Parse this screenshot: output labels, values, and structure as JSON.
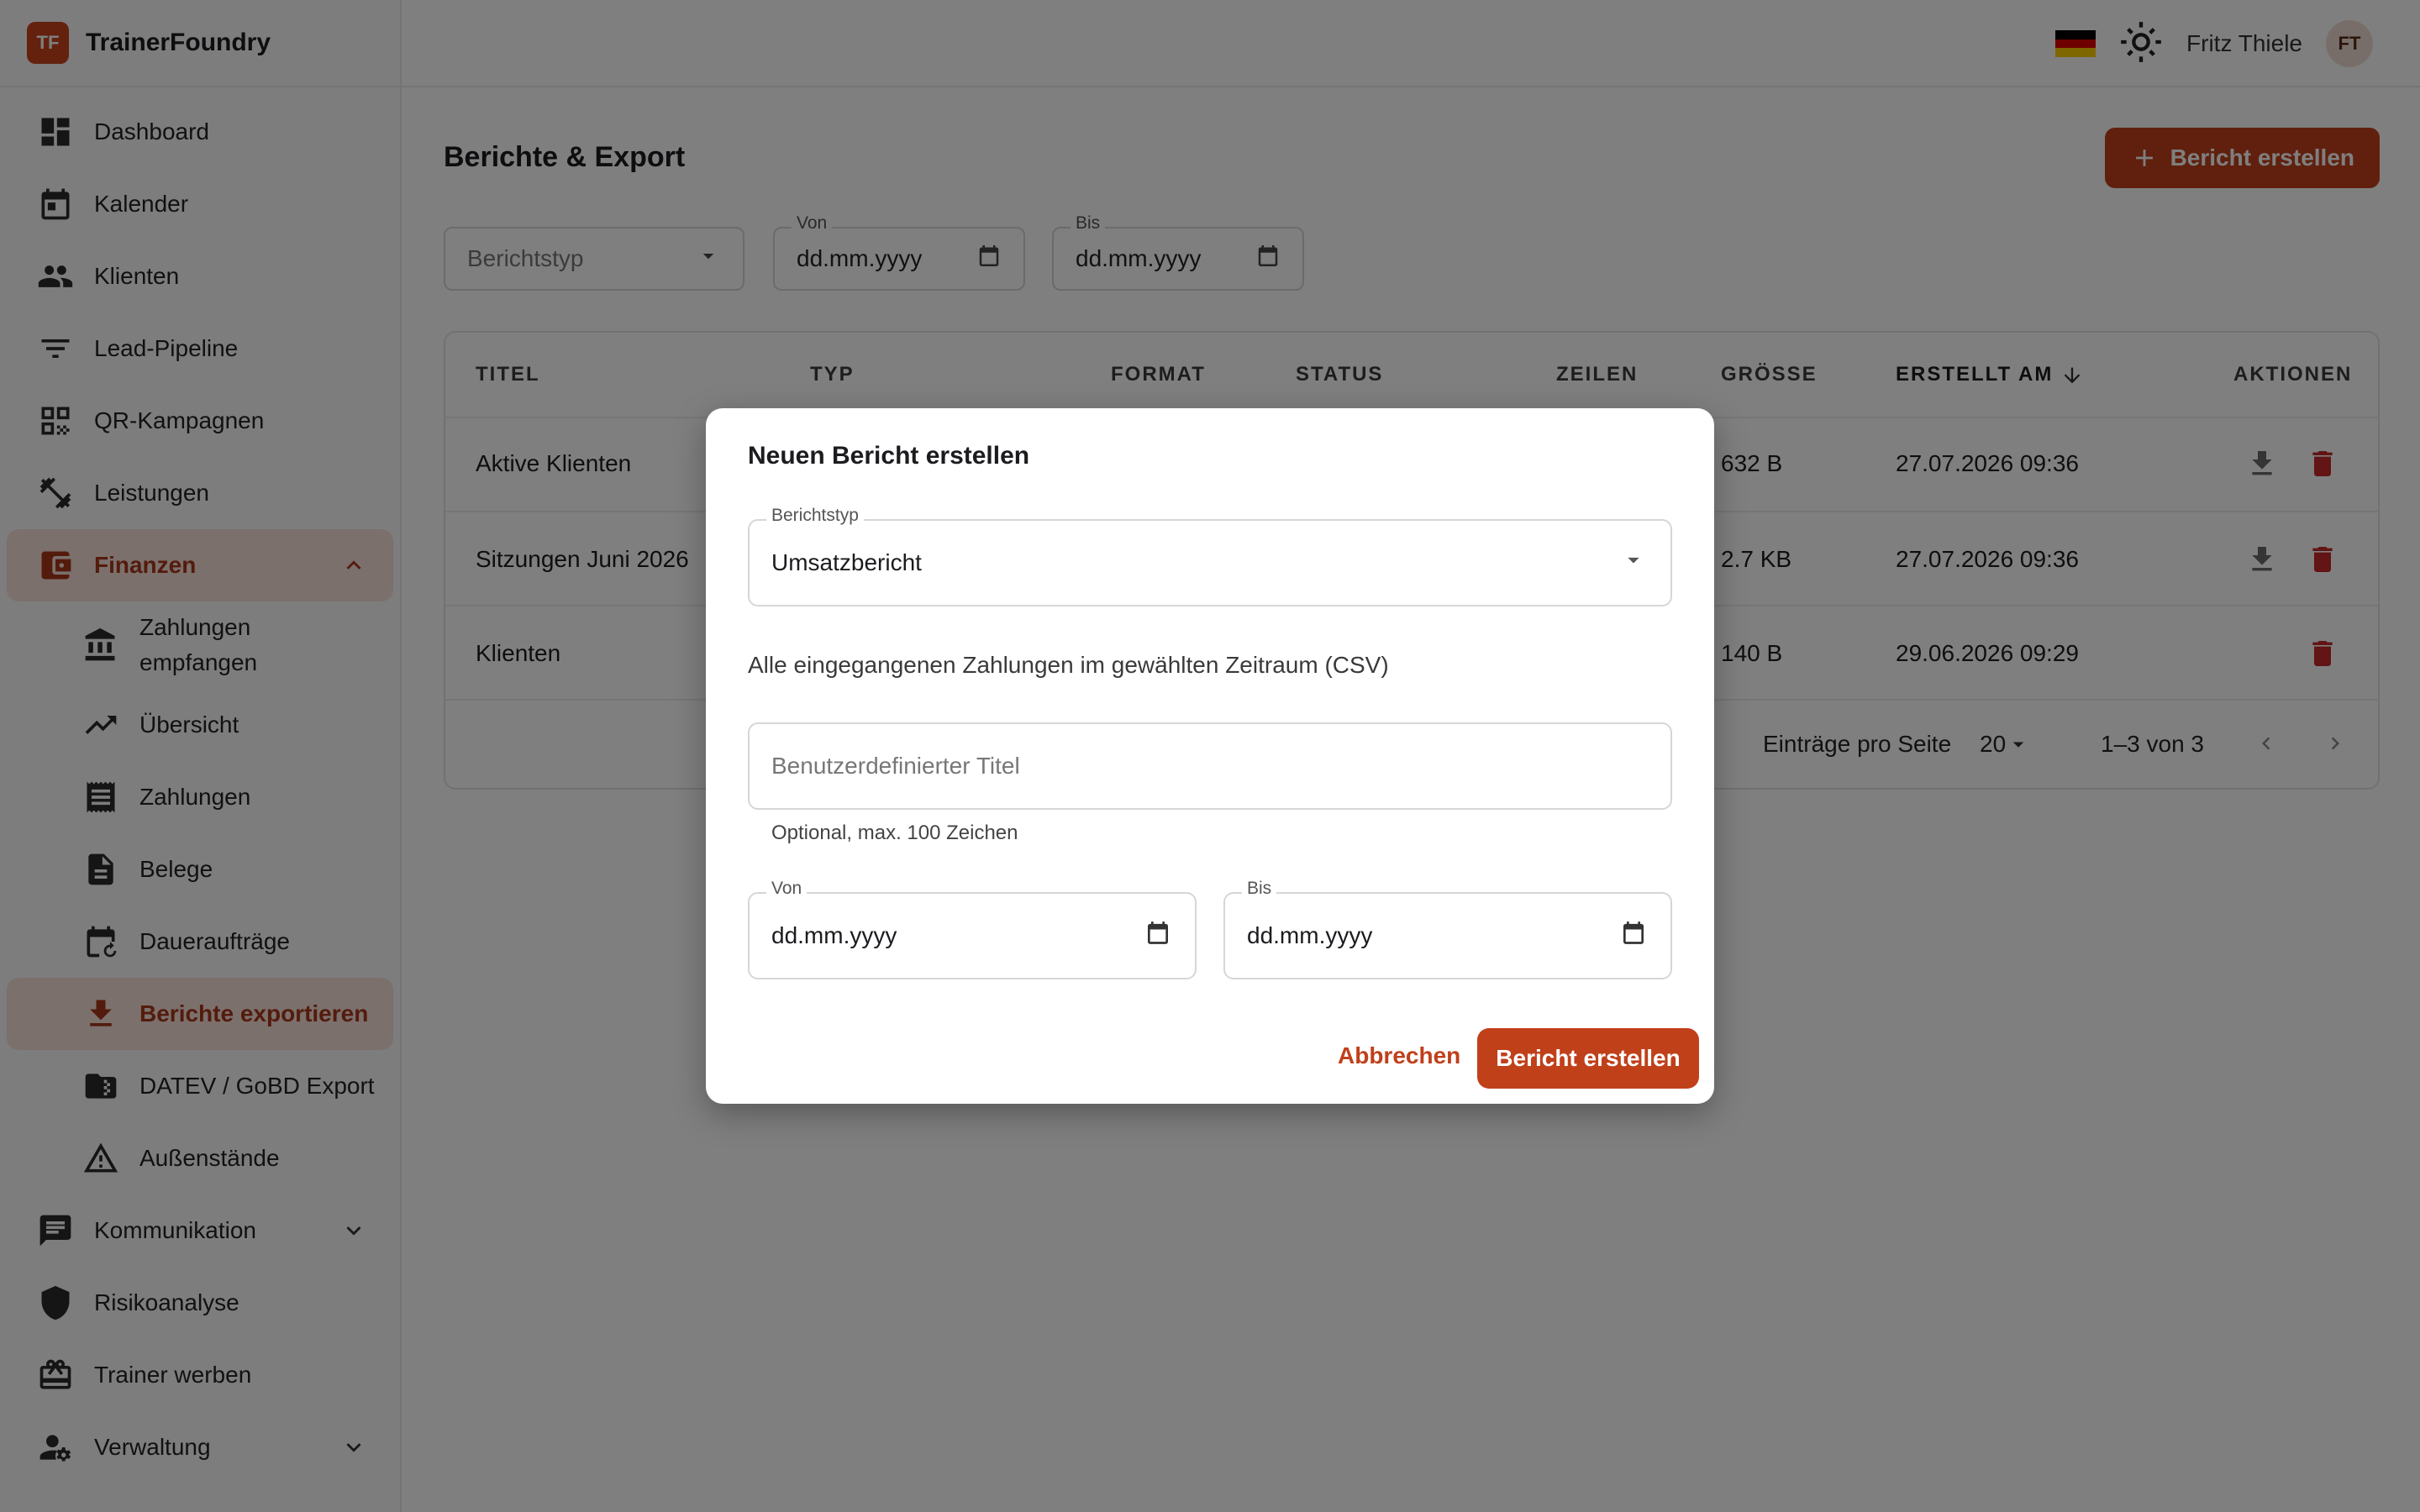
{
  "app": {
    "logo": "TF",
    "name": "TrainerFoundry"
  },
  "sidebar": {
    "items": [
      {
        "label": "Dashboard",
        "icon": "dashboard-icon"
      },
      {
        "label": "Kalender",
        "icon": "calendar-icon"
      },
      {
        "label": "Klienten",
        "icon": "people-icon"
      },
      {
        "label": "Lead-Pipeline",
        "icon": "filter-icon"
      },
      {
        "label": "QR-Kampagnen",
        "icon": "qr-code-icon"
      },
      {
        "label": "Leistungen",
        "icon": "fitness-icon"
      },
      {
        "label": "Finanzen",
        "icon": "wallet-icon"
      },
      {
        "label": "Kommunikation",
        "icon": "chat-icon"
      },
      {
        "label": "Risikoanalyse",
        "icon": "shield-icon"
      },
      {
        "label": "Trainer werben",
        "icon": "gift-icon"
      },
      {
        "label": "Verwaltung",
        "icon": "admin-icon"
      }
    ],
    "finance_sub": [
      {
        "label_line1": "Zahlungen",
        "label_line2": "empfangen",
        "icon": "bank-icon"
      },
      {
        "label": "Übersicht",
        "icon": "trending-up-icon"
      },
      {
        "label": "Zahlungen",
        "icon": "receipt-icon"
      },
      {
        "label": "Belege",
        "icon": "document-icon"
      },
      {
        "label": "Daueraufträge",
        "icon": "recurring-calendar-icon"
      },
      {
        "label": "Berichte exportieren",
        "icon": "download-icon"
      },
      {
        "label": "DATEV / GoBD Export",
        "icon": "folder-icon"
      },
      {
        "label": "Außenstände",
        "icon": "warning-icon"
      }
    ]
  },
  "topbar": {
    "language_flag": "flag-de-icon",
    "theme_icon": "sun-icon",
    "user_name": "Fritz Thiele",
    "user_initials": "FT"
  },
  "page": {
    "title": "Berichte & Export",
    "create_button": "Bericht erstellen",
    "filters": {
      "report_type_placeholder": "Berichtstyp",
      "from_label": "Von",
      "from_value": "dd.mm.yyyy",
      "to_label": "Bis",
      "to_value": "dd.mm.yyyy"
    }
  },
  "table": {
    "columns": [
      "TITEL",
      "TYP",
      "FORMAT",
      "STATUS",
      "ZEILEN",
      "GRÖSSE",
      "ERSTELLT AM",
      "AKTIONEN"
    ],
    "rows": [
      {
        "title": "Aktive Klienten",
        "size": "632 B",
        "created": "27.07.2026 09:36",
        "download": true
      },
      {
        "title": "Sitzungen Juni 2026",
        "size": "2.7 KB",
        "created": "27.07.2026 09:36",
        "download": true
      },
      {
        "title": "Klienten",
        "size": "140 B",
        "created": "29.06.2026 09:29",
        "download": false
      }
    ],
    "pagination": {
      "per_page_label": "Einträge pro Seite",
      "per_page": "20",
      "range": "1–3 von 3"
    }
  },
  "dialog": {
    "title": "Neuen Bericht erstellen",
    "type_label": "Berichtstyp",
    "type_value": "Umsatzbericht",
    "description": "Alle eingegangenen Zahlungen im gewählten Zeitraum (CSV)",
    "custom_title_placeholder": "Benutzerdefinierter Titel",
    "custom_title_helper": "Optional, max. 100 Zeichen",
    "from_label": "Von",
    "from_value": "dd.mm.yyyy",
    "to_label": "Bis",
    "to_value": "dd.mm.yyyy",
    "cancel": "Abbrechen",
    "submit": "Bericht erstellen"
  },
  "colors": {
    "brand": "#c0401a",
    "active_bg": "#f6e1d9",
    "delete": "#c62828"
  }
}
